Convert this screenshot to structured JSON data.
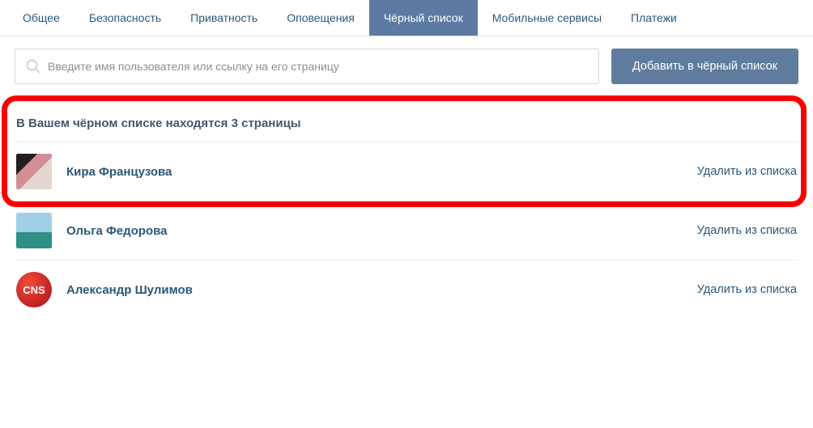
{
  "tabs": [
    {
      "label": "Общее",
      "active": false
    },
    {
      "label": "Безопасность",
      "active": false
    },
    {
      "label": "Приватность",
      "active": false
    },
    {
      "label": "Оповещения",
      "active": false
    },
    {
      "label": "Чёрный список",
      "active": true
    },
    {
      "label": "Мобильные сервисы",
      "active": false
    },
    {
      "label": "Платежи",
      "active": false
    }
  ],
  "search": {
    "placeholder": "Введите имя пользователя или ссылку на его страницу",
    "add_button": "Добавить в чёрный список"
  },
  "heading": "В Вашем чёрном списке находятся 3 страницы",
  "remove_label": "Удалить из списка",
  "users": [
    {
      "name": "Кира Французова",
      "avatar_class": "av-1",
      "avatar_text": ""
    },
    {
      "name": "Ольга Федорова",
      "avatar_class": "av-2",
      "avatar_text": ""
    },
    {
      "name": "Александр Шулимов",
      "avatar_class": "av-3",
      "avatar_text": "CNS"
    }
  ]
}
